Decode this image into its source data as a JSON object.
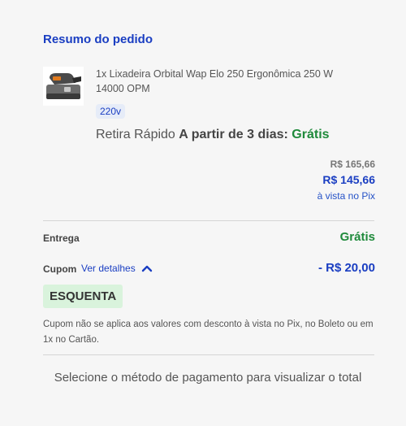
{
  "summary": {
    "title": "Resumo do pedido"
  },
  "item": {
    "name": "1x Lixadeira Orbital Wap Elo 250 Ergonômica 250 W 14000 OPM",
    "variant": "220v",
    "pickup_prefix": "Retira Rápido",
    "pickup_time": "A partir de 3 dias:",
    "pickup_price": "Grátis",
    "price_old": "R$ 165,66",
    "price_new": "R$ 145,66",
    "price_note": "à vista no Pix",
    "image_icon": "orbital-sander-product-image"
  },
  "delivery": {
    "label": "Entrega",
    "value": "Grátis"
  },
  "coupon": {
    "label": "Cupom",
    "details_link": "Ver detalhes",
    "value": "- R$ 20,00",
    "code": "ESQUENTA",
    "disclaimer": "Cupom não se aplica aos valores com desconto à vista no Pix, no Boleto ou em 1x no Cartão.",
    "toggle_icon": "chevron-up-icon"
  },
  "footer": {
    "message": "Selecione o método de pagamento para visualizar o total"
  },
  "colors": {
    "accent_blue": "#1a3ec2",
    "success_green": "#1f8a3b",
    "chip_green": "#d9f3dc"
  }
}
